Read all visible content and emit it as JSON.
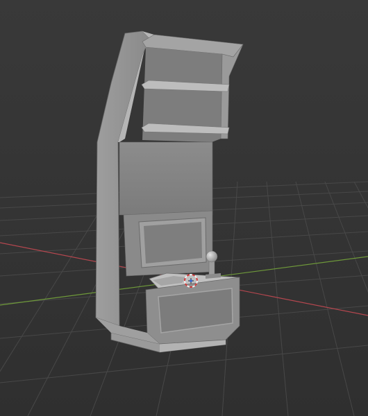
{
  "viewport": {
    "background": "#3d3d3d",
    "grid_color": "#4a4a4a",
    "x_axis_color": "#c94a52",
    "y_axis_color": "#7fa143"
  },
  "model": {
    "base_color": "#8f8f8f",
    "light_color": "#a8a8a8",
    "dark_color": "#6f6f6f",
    "edge_color": "#5c5c5c"
  },
  "cursor": {
    "icon": "3d-cursor-icon",
    "ring_colors": [
      "#d23a3a",
      "#f0f0f0"
    ]
  }
}
